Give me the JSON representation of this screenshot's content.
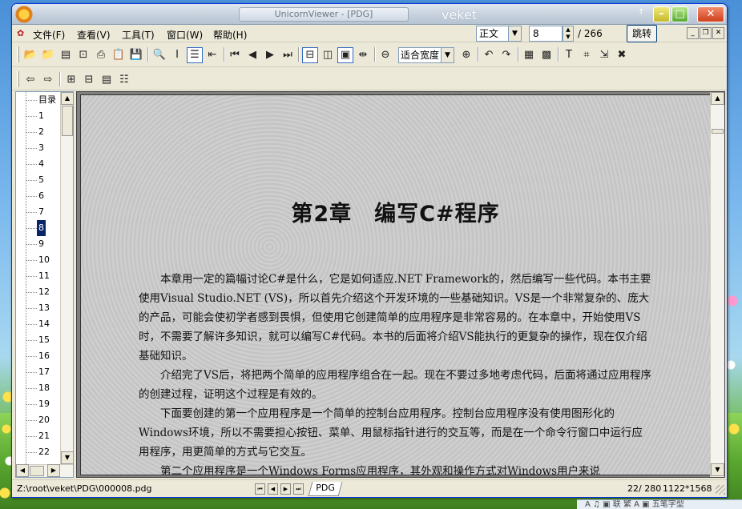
{
  "window": {
    "title": "UnicornViewer - [PDG]",
    "user": "veket",
    "pin_glyph": "↑",
    "minimize": "–",
    "maximize": "□",
    "close": "✕"
  },
  "menu": {
    "items": [
      "文件(F)",
      "查看(V)",
      "工具(T)",
      "窗口(W)",
      "帮助(H)"
    ],
    "page_mode": "正文",
    "page_number": "8",
    "page_total": "/ 266",
    "goto_label": "跳转",
    "mdi_min": "_",
    "mdi_restore": "❐",
    "mdi_close": "✕"
  },
  "toolbar": {
    "zoom_mode": "适合宽度"
  },
  "outline": {
    "root_label": "目录",
    "items": [
      "1",
      "2",
      "3",
      "4",
      "5",
      "6",
      "7",
      "8",
      "9",
      "10",
      "11",
      "12",
      "13",
      "14",
      "15",
      "16",
      "17",
      "18",
      "19",
      "20",
      "21",
      "22"
    ],
    "selected": "8"
  },
  "document": {
    "chapter_title": "第2章　编写C#程序",
    "paragraphs": [
      "本章用一定的篇幅讨论C#是什么，它是如何适应.NET Framework的，然后编写一些代码。本书主要使用Visual Studio.NET (VS)，所以首先介绍这个开发环境的一些基础知识。VS是一个非常复杂的、庞大的产品，可能会使初学者感到畏惧，但使用它创建简单的应用程序是非常容易的。在本章中，开始使用VS时，不需要了解许多知识，就可以编写C#代码。本书的后面将介绍VS能执行的更复杂的操作，现在仅介绍基础知识。",
      "介绍完了VS后，将把两个简单的应用程序组合在一起。现在不要过多地考虑代码，后面将通过应用程序的创建过程，证明这个过程是有效的。",
      "下面要创建的第一个应用程序是一个简单的控制台应用程序。控制台应用程序没有使用图形化的Windows环境，所以不需要担心按钮、菜单、用鼠标指针进行的交互等，而是在一个命令行窗口中运行应用程序，用更简单的方式与它交互。",
      "第二个应用程序是一个Windows Forms应用程序，其外观和操作方式对Windows用户来说"
    ]
  },
  "status": {
    "file_path": "Z:\\root\\veket\\PDG\\000008.pdg",
    "tab_label": "PDG",
    "page_counter": "22/ 280",
    "resolution": "1122*1568"
  },
  "taskbar": {
    "text": "A ♫ ▣ 联 繁 A ▣ 五笔字型"
  }
}
